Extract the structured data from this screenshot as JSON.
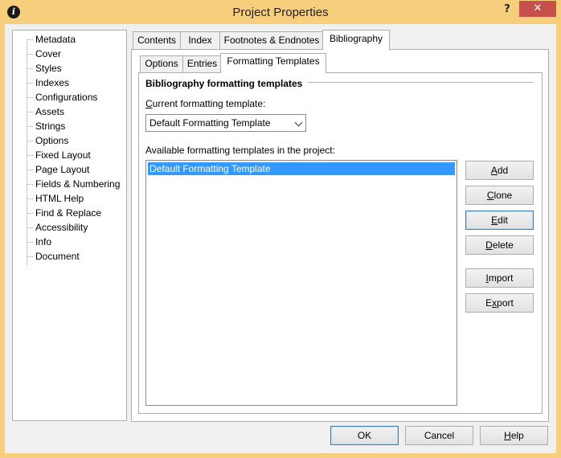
{
  "window": {
    "title": "Project Properties",
    "app_icon_glyph": "i",
    "help_glyph": "?",
    "close_glyph": "✕",
    "accent_color": "#f7cf7c",
    "close_color": "#c7504b"
  },
  "tree": {
    "items": [
      {
        "label": "Metadata"
      },
      {
        "label": "Cover"
      },
      {
        "label": "Styles"
      },
      {
        "label": "Indexes"
      },
      {
        "label": "Configurations"
      },
      {
        "label": "Assets"
      },
      {
        "label": "Strings"
      },
      {
        "label": "Options"
      },
      {
        "label": "Fixed Layout"
      },
      {
        "label": "Page Layout"
      },
      {
        "label": "Fields & Numbering"
      },
      {
        "label": "HTML Help"
      },
      {
        "label": "Find & Replace"
      },
      {
        "label": "Accessibility"
      },
      {
        "label": "Info"
      },
      {
        "label": "Document"
      }
    ],
    "selected": "Indexes"
  },
  "outer_tabs": [
    {
      "label": "Contents"
    },
    {
      "label": "Index"
    },
    {
      "label": "Footnotes & Endnotes"
    },
    {
      "label": "Bibliography"
    }
  ],
  "outer_tab_active": "Bibliography",
  "inner_tabs": [
    {
      "label": "Options"
    },
    {
      "label": "Entries"
    },
    {
      "label": "Formatting Templates"
    }
  ],
  "inner_tab_active": "Formatting Templates",
  "panel": {
    "section_title": "Bibliography formatting templates",
    "current_label_pre": "",
    "current_label_key": "C",
    "current_label_post": "urrent formatting template:",
    "current_value": "Default Formatting Template",
    "available_label_pre": "Available formatting templates in the pro",
    "available_label_key": "j",
    "available_label_post": "ect:",
    "templates": [
      "Default Formatting Template"
    ],
    "selected_template": "Default Formatting Template"
  },
  "side_buttons": {
    "add": {
      "key": "A",
      "rest": "dd"
    },
    "clone": {
      "key": "C",
      "rest": "lone"
    },
    "edit": {
      "key": "E",
      "rest": "dit"
    },
    "delete": {
      "key": "D",
      "rest": "elete"
    },
    "import": {
      "key": "I",
      "rest": "mport"
    },
    "export": {
      "pre": "E",
      "key": "x",
      "rest": "port"
    }
  },
  "footer": {
    "ok": "OK",
    "cancel": "Cancel",
    "help_key": "H",
    "help_rest": "elp"
  }
}
